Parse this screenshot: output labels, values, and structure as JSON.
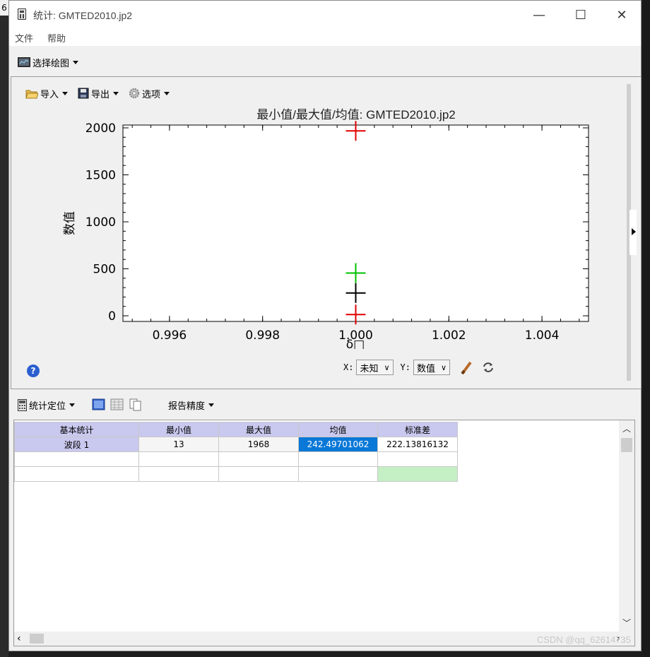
{
  "desktop": {
    "corner_text": "6",
    "watermark": "CSDN @qq_62614735"
  },
  "window": {
    "title": "统计: GMTED2010.jp2",
    "controls": {
      "minimize": "—",
      "maximize": "☐",
      "close": "✕"
    }
  },
  "menu": {
    "file": "文件",
    "help": "帮助"
  },
  "toolbar": {
    "select_plot": "选择绘图"
  },
  "plot_toolbar": {
    "import": "导入",
    "export": "导出",
    "options": "选项"
  },
  "chart_data": {
    "type": "scatter",
    "title": "最小值/最大值/均值: GMTED2010.jp2",
    "xlabel": "δ□",
    "ylabel": "数值",
    "xlim": [
      0.995,
      1.005
    ],
    "ylim": [
      -60,
      2030
    ],
    "xticks": [
      0.996,
      0.998,
      1.0,
      1.002,
      1.004
    ],
    "xtick_labels": [
      "0.996",
      "0.998",
      "1.000",
      "1.002",
      "1.004"
    ],
    "yticks": [
      0,
      500,
      1000,
      1500,
      2000
    ],
    "ytick_labels": [
      "0",
      "500",
      "1000",
      "1500",
      "2000"
    ],
    "points": [
      {
        "x": 1.0,
        "y": 1968,
        "color": "#e00000"
      },
      {
        "x": 1.0,
        "y": 455,
        "color": "#00c000"
      },
      {
        "x": 1.0,
        "y": 242.5,
        "color": "#000000"
      },
      {
        "x": 1.0,
        "y": 13,
        "color": "#e00000"
      }
    ],
    "legend": "none"
  },
  "axis_selectors": {
    "x_label": "X:",
    "x_value": "未知",
    "y_label": "Y:",
    "y_value": "数值"
  },
  "stats_toolbar": {
    "stats_position": "统计定位",
    "report_precision": "报告精度"
  },
  "table": {
    "headers": [
      "基本统计",
      "最小值",
      "最大值",
      "均值",
      "标准差"
    ],
    "rows": [
      [
        "波段 1",
        "13",
        "1968",
        "242.49701062",
        "222.13816132"
      ]
    ]
  }
}
